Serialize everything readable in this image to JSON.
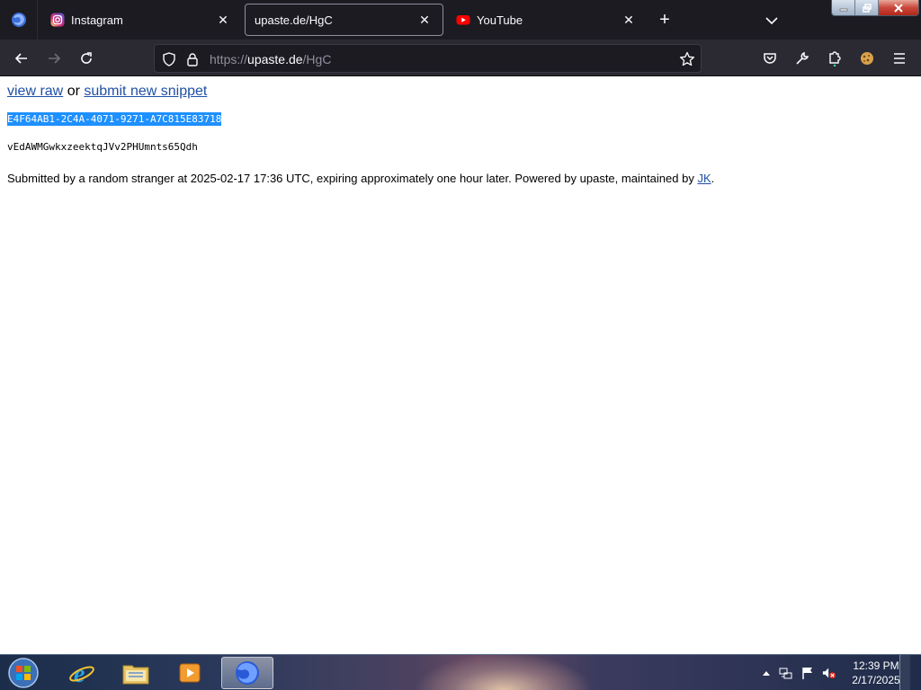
{
  "browser": {
    "tabs": [
      {
        "title": "Instagram",
        "active": false,
        "favicon": "instagram-icon"
      },
      {
        "title": "upaste.de/HgC",
        "active": true,
        "favicon": "none"
      },
      {
        "title": "YouTube",
        "active": false,
        "favicon": "youtube-icon"
      }
    ],
    "close_glyph": "✕",
    "url": {
      "scheme": "https://",
      "host": "upaste.de",
      "path": "/HgC"
    }
  },
  "page": {
    "view_raw": "view raw",
    "or_text": "or",
    "submit_new": "submit new snippet",
    "uuid": "E4F64AB1-2C4A-4071-9271-A7C815E83718",
    "snippet": "vEdAWMGwkxzeektqJVv2PHUmnts65Qdh",
    "footer_text": "Submitted by a random stranger at 2025-02-17 17:36 UTC, expiring approximately one hour later. Powered by upaste, maintained by",
    "footer_link": "JK",
    "footer_end": "."
  },
  "taskbar": {
    "time": "12:39 PM",
    "date": "2/17/2025"
  },
  "colors": {
    "tabstrip": "#1c1b22",
    "toolbar": "#2b2a33",
    "link": "#1f50a6",
    "selection": "#1e90ff"
  }
}
